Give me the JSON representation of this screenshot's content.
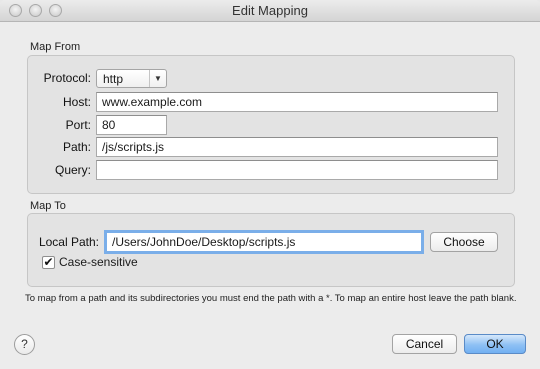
{
  "window": {
    "title": "Edit Mapping"
  },
  "map_from": {
    "label": "Map From",
    "protocol_label": "Protocol:",
    "protocol_value": "http",
    "host_label": "Host:",
    "host_value": "www.example.com",
    "port_label": "Port:",
    "port_value": "80",
    "path_label": "Path:",
    "path_value": "/js/scripts.js",
    "query_label": "Query:",
    "query_value": ""
  },
  "map_to": {
    "label": "Map To",
    "local_path_label": "Local Path:",
    "local_path_value": "/Users/JohnDoe/Desktop/scripts.js",
    "choose_label": "Choose",
    "case_sensitive_label": "Case-sensitive",
    "case_sensitive_checked": true
  },
  "note": "To map from a path and its subdirectories you must end the path with a *. To map an entire host leave the path blank.",
  "footer": {
    "help_label": "?",
    "cancel_label": "Cancel",
    "ok_label": "OK"
  }
}
